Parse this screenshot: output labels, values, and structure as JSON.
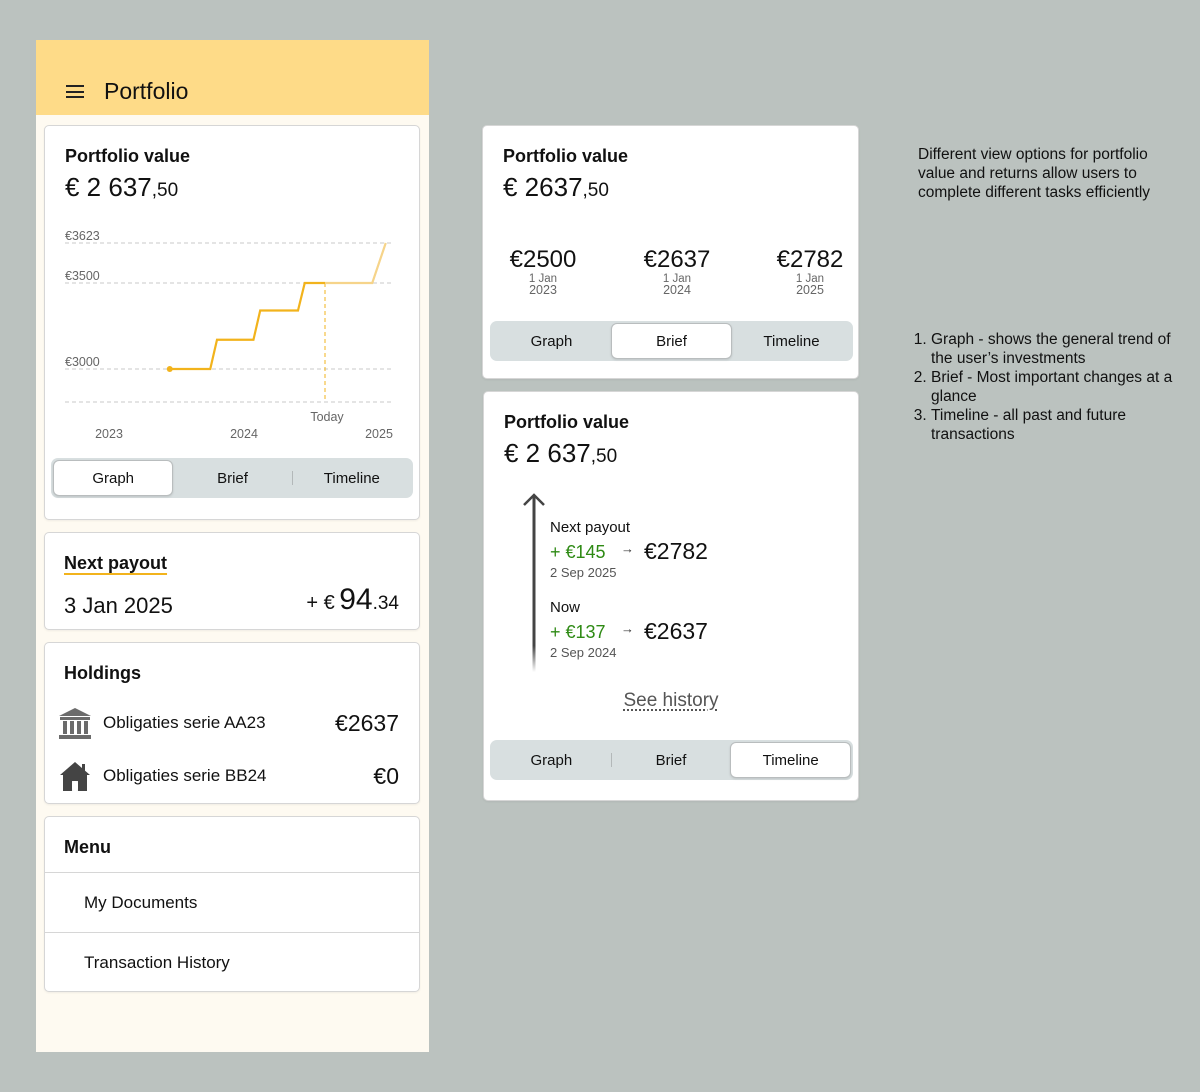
{
  "app": {
    "title": "Portfolio"
  },
  "portfolio_card": {
    "title": "Portfolio value",
    "value_main": "€ 2 637",
    "value_cents": ",50",
    "today_label": "Today",
    "segments": [
      "Graph",
      "Brief",
      "Timeline"
    ],
    "active_segment": "Graph"
  },
  "chart_data": {
    "type": "line",
    "y_tick_labels": [
      "€3623",
      "€3500",
      "€3000"
    ],
    "x_tick_labels": [
      "2023",
      "2024",
      "2025"
    ],
    "marker_label": "Today",
    "series": [
      {
        "x": [
          2023.45,
          2023.75,
          2023.8,
          2024.07,
          2024.12,
          2024.4,
          2024.45,
          2024.6,
          2024.95,
          2025.05
        ],
        "y": [
          3000,
          3000,
          3170,
          3170,
          3340,
          3340,
          3500,
          3500,
          3500,
          3623
        ]
      }
    ],
    "grid": true,
    "accent": "#f2b31c"
  },
  "payout": {
    "title": "Next payout",
    "date": "3 Jan 2025",
    "prefix": "+ €",
    "amount_main": "94",
    "amount_cents": ".34"
  },
  "holdings": {
    "title": "Holdings",
    "items": [
      {
        "name": "Obligaties serie AA23",
        "value": "€2637",
        "icon": "bank-icon"
      },
      {
        "name": "Obligaties serie BB24",
        "value": "€0",
        "icon": "house-icon"
      }
    ]
  },
  "menu": {
    "title": "Menu",
    "items": [
      "My Documents",
      "Transaction History"
    ]
  },
  "brief_card": {
    "title": "Portfolio value",
    "value_main": "€ 2637",
    "value_cents": ",50",
    "items": [
      {
        "amount": "€2500",
        "day": "1 Jan",
        "year": "2023"
      },
      {
        "amount": "€2637",
        "day": "1 Jan",
        "year": "2024"
      },
      {
        "amount": "€2782",
        "day": "1 Jan",
        "year": "2025"
      }
    ],
    "segments": [
      "Graph",
      "Brief",
      "Timeline"
    ],
    "active_segment": "Brief"
  },
  "timeline_card": {
    "title": "Portfolio value",
    "value_main": "€ 2 637",
    "value_cents": ",50",
    "entries": [
      {
        "label": "Next payout",
        "delta": "+ €145",
        "total": "€2782",
        "date": "2 Sep 2025"
      },
      {
        "label": "Now",
        "delta": "+ €137",
        "total": "€2637",
        "date": "2 Sep 2024"
      }
    ],
    "see_history": "See history",
    "segments": [
      "Graph",
      "Brief",
      "Timeline"
    ],
    "active_segment": "Timeline"
  },
  "notes": {
    "intro": "Different view options for portfolio value and returns allow users to complete different tasks efficiently",
    "list": [
      "Graph - shows the general trend of the user’s investments",
      "Brief - Most important changes at a glance",
      "Timeline - all past and future transactions"
    ]
  }
}
